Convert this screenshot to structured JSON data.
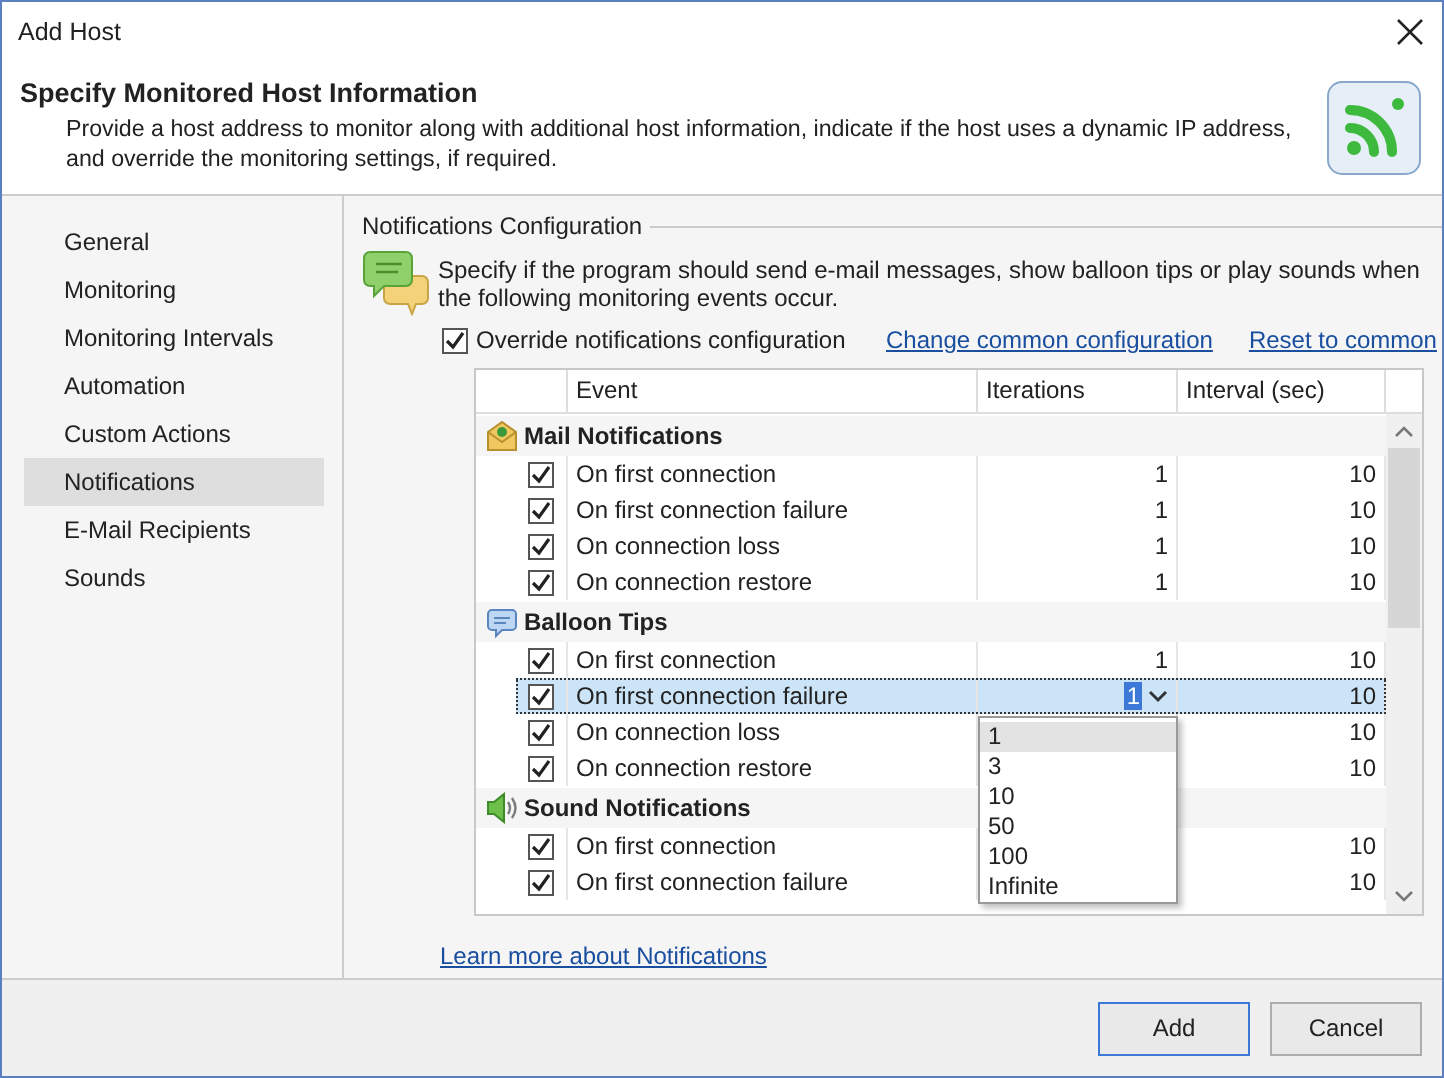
{
  "window": {
    "title": "Add Host"
  },
  "header": {
    "title": "Specify Monitored Host Information",
    "description": "Provide a host address to monitor along with additional host information, indicate if the host uses a dynamic IP address, and override the monitoring settings, if required."
  },
  "sidebar": {
    "items": [
      {
        "label": "General",
        "selected": false
      },
      {
        "label": "Monitoring",
        "selected": false
      },
      {
        "label": "Monitoring Intervals",
        "selected": false
      },
      {
        "label": "Automation",
        "selected": false
      },
      {
        "label": "Custom Actions",
        "selected": false
      },
      {
        "label": "Notifications",
        "selected": true
      },
      {
        "label": "E-Mail Recipients",
        "selected": false
      },
      {
        "label": "Sounds",
        "selected": false
      }
    ]
  },
  "section": {
    "title": "Notifications Configuration",
    "description": "Specify if the program should send e-mail messages, show balloon tips or play sounds when the following monitoring events occur.",
    "override": {
      "label": "Override notifications configuration",
      "checked": true
    },
    "links": [
      "Change common configuration",
      "Reset to common"
    ]
  },
  "table": {
    "columns": [
      "Event",
      "Iterations",
      "Interval (sec)"
    ],
    "groups": [
      {
        "title": "Mail Notifications",
        "kind": "mail",
        "rows": [
          {
            "event": "On first connection",
            "checked": true,
            "iterations": "1",
            "interval": "10",
            "selected": false
          },
          {
            "event": "On first connection failure",
            "checked": true,
            "iterations": "1",
            "interval": "10",
            "selected": false
          },
          {
            "event": "On connection loss",
            "checked": true,
            "iterations": "1",
            "interval": "10",
            "selected": false
          },
          {
            "event": "On connection restore",
            "checked": true,
            "iterations": "1",
            "interval": "10",
            "selected": false
          }
        ]
      },
      {
        "title": "Balloon Tips",
        "kind": "balloon",
        "rows": [
          {
            "event": "On first connection",
            "checked": true,
            "iterations": "1",
            "interval": "10",
            "selected": false
          },
          {
            "event": "On first connection failure",
            "checked": true,
            "editor": "1",
            "interval": "10",
            "selected": true
          },
          {
            "event": "On connection loss",
            "checked": true,
            "interval": "10",
            "selected": false
          },
          {
            "event": "On connection restore",
            "checked": true,
            "interval": "10",
            "selected": false
          }
        ]
      },
      {
        "title": "Sound Notifications",
        "kind": "sound",
        "rows": [
          {
            "event": "On first connection",
            "checked": true,
            "interval": "10",
            "selected": false
          },
          {
            "event": "On first connection failure",
            "checked": true,
            "interval": "10",
            "selected": false
          }
        ]
      }
    ],
    "dropdown": [
      {
        "label": "1",
        "selected": true
      },
      {
        "label": "3",
        "selected": false
      },
      {
        "label": "10",
        "selected": false
      },
      {
        "label": "50",
        "selected": false
      },
      {
        "label": "100",
        "selected": false
      },
      {
        "label": "Infinite",
        "selected": false
      }
    ]
  },
  "learn_more": "Learn more about Notifications",
  "buttons": [
    "Add",
    "Cancel"
  ]
}
